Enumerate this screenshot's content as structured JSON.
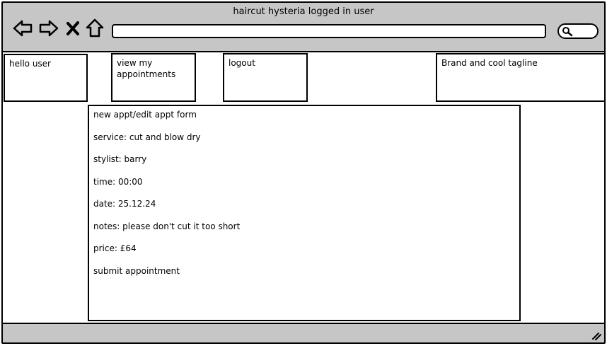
{
  "window": {
    "title": "haircut hysteria logged in user"
  },
  "toolbar": {
    "back_icon": "arrow-left-icon",
    "forward_icon": "arrow-right-icon",
    "close_icon": "close-icon",
    "home_icon": "home-icon",
    "address": "",
    "search_icon": "search-icon"
  },
  "navbar": {
    "greeting": "hello user",
    "view_appointments": "view my appointments",
    "logout": "logout",
    "brand": "Brand and cool tagline"
  },
  "form": {
    "title": "new appt/edit appt form",
    "service": "service: cut and blow dry",
    "stylist": "stylist: barry",
    "time": "time: 00:00",
    "date": "date: 25.12.24",
    "notes": "notes: please don't cut it too short",
    "price": "price: £64",
    "submit_label": "submit appointment"
  },
  "colors": {
    "chrome_gray": "#c6c6c6",
    "border": "#000000",
    "background": "#ffffff"
  }
}
